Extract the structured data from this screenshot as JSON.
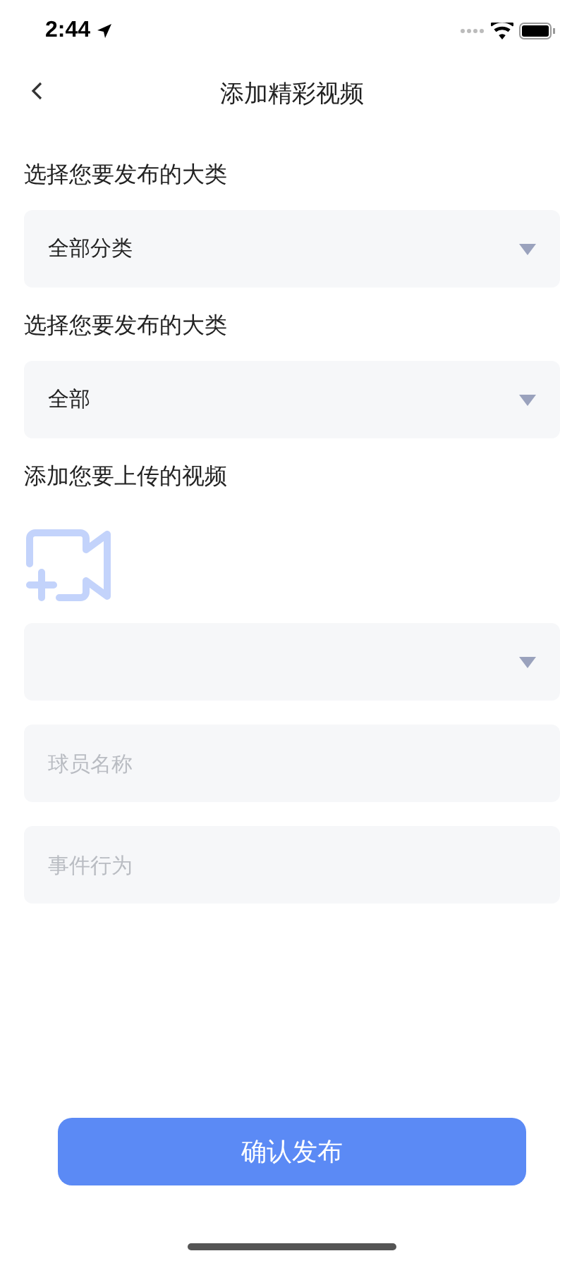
{
  "status_bar": {
    "time": "2:44"
  },
  "header": {
    "title": "添加精彩视频"
  },
  "form": [
    {
      "kind": "label",
      "text": "选择您要发布的大类"
    },
    {
      "kind": "select",
      "value": "全部分类"
    },
    {
      "kind": "label",
      "text": "选择您要发布的大类"
    },
    {
      "kind": "select",
      "value": "全部"
    },
    {
      "kind": "label",
      "text": "添加您要上传的视频"
    },
    {
      "kind": "upload"
    },
    {
      "kind": "select"
    },
    {
      "kind": "input",
      "placeholder": "球员名称"
    },
    {
      "kind": "input",
      "placeholder": "事件行为"
    }
  ],
  "submit": {
    "label": "确认发布"
  }
}
